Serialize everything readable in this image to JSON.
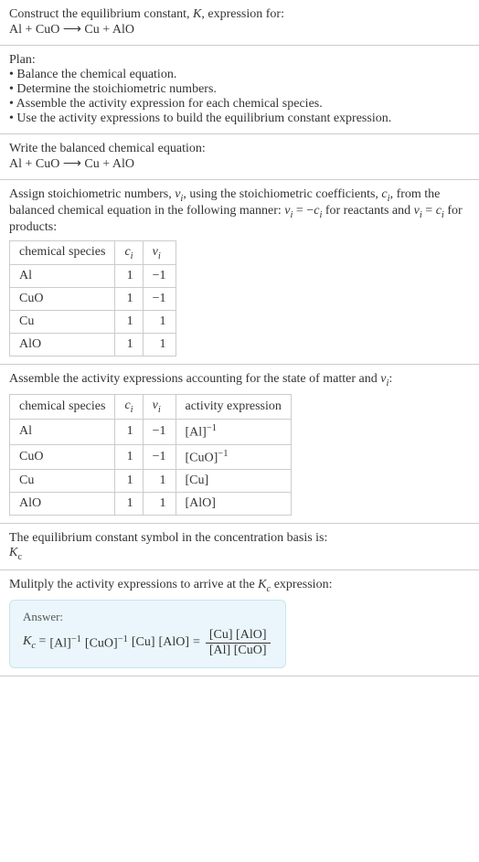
{
  "header": {
    "prompt": "Construct the equilibrium constant, K, expression for:",
    "equation": "Al + CuO ⟶ Cu + AlO"
  },
  "plan": {
    "title": "Plan:",
    "items": [
      "• Balance the chemical equation.",
      "• Determine the stoichiometric numbers.",
      "• Assemble the activity expression for each chemical species.",
      "• Use the activity expressions to build the equilibrium constant expression."
    ]
  },
  "balanced": {
    "title": "Write the balanced chemical equation:",
    "equation": "Al + CuO ⟶ Cu + AlO"
  },
  "stoich": {
    "intro": "Assign stoichiometric numbers, νᵢ, using the stoichiometric coefficients, cᵢ, from the balanced chemical equation in the following manner: νᵢ = −cᵢ for reactants and νᵢ = cᵢ for products:",
    "headers": {
      "species": "chemical species",
      "ci": "cᵢ",
      "vi": "νᵢ"
    },
    "rows": [
      {
        "species": "Al",
        "ci": "1",
        "vi": "−1"
      },
      {
        "species": "CuO",
        "ci": "1",
        "vi": "−1"
      },
      {
        "species": "Cu",
        "ci": "1",
        "vi": "1"
      },
      {
        "species": "AlO",
        "ci": "1",
        "vi": "1"
      }
    ]
  },
  "activity": {
    "intro": "Assemble the activity expressions accounting for the state of matter and νᵢ:",
    "headers": {
      "species": "chemical species",
      "ci": "cᵢ",
      "vi": "νᵢ",
      "expr": "activity expression"
    },
    "rows": [
      {
        "species": "Al",
        "ci": "1",
        "vi": "−1",
        "expr_base": "[Al]",
        "expr_sup": "−1"
      },
      {
        "species": "CuO",
        "ci": "1",
        "vi": "−1",
        "expr_base": "[CuO]",
        "expr_sup": "−1"
      },
      {
        "species": "Cu",
        "ci": "1",
        "vi": "1",
        "expr_base": "[Cu]",
        "expr_sup": ""
      },
      {
        "species": "AlO",
        "ci": "1",
        "vi": "1",
        "expr_base": "[AlO]",
        "expr_sup": ""
      }
    ]
  },
  "basis": {
    "line1": "The equilibrium constant symbol in the concentration basis is:",
    "symbol": "K",
    "sub": "c"
  },
  "multiply": {
    "line": "Mulitply the activity expressions to arrive at the Kc expression:"
  },
  "answer": {
    "label": "Answer:",
    "lhs": "Kc",
    "eq1_parts": [
      "[Al]",
      "−1",
      "[CuO]",
      "−1",
      "[Cu]",
      "[AlO]"
    ],
    "frac_num": "[Cu] [AlO]",
    "frac_den": "[Al] [CuO]"
  },
  "chart_data": {
    "type": "table",
    "tables": [
      {
        "title": "Stoichiometric numbers",
        "columns": [
          "chemical species",
          "cᵢ",
          "νᵢ"
        ],
        "rows": [
          [
            "Al",
            1,
            -1
          ],
          [
            "CuO",
            1,
            -1
          ],
          [
            "Cu",
            1,
            1
          ],
          [
            "AlO",
            1,
            1
          ]
        ]
      },
      {
        "title": "Activity expressions",
        "columns": [
          "chemical species",
          "cᵢ",
          "νᵢ",
          "activity expression"
        ],
        "rows": [
          [
            "Al",
            1,
            -1,
            "[Al]^(-1)"
          ],
          [
            "CuO",
            1,
            -1,
            "[CuO]^(-1)"
          ],
          [
            "Cu",
            1,
            1,
            "[Cu]"
          ],
          [
            "AlO",
            1,
            1,
            "[AlO]"
          ]
        ]
      }
    ]
  }
}
